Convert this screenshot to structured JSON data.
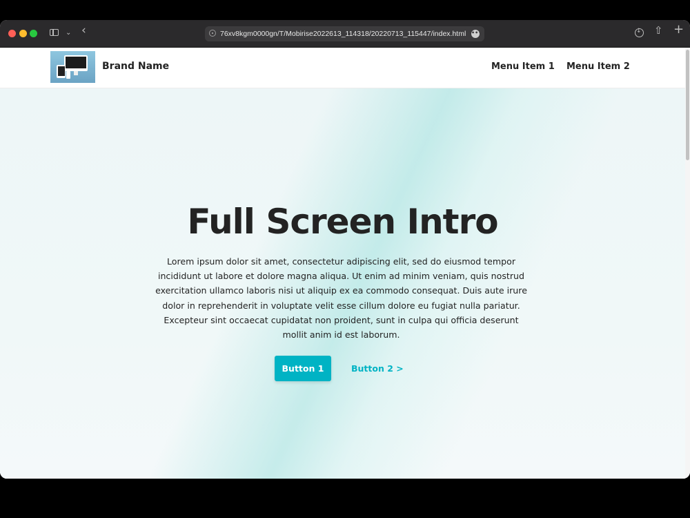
{
  "browser": {
    "url": "76xv8kgm0000gn/T/Mobirise2022613_114318/20220713_115447/index.html",
    "more_glyph": "•••",
    "back_glyph": "‹",
    "chevron_glyph": "⌄",
    "share_glyph": "⇧",
    "plus_glyph": "+"
  },
  "navbar": {
    "brand_name": "Brand Name",
    "menu_items": [
      {
        "label": "Menu Item 1"
      },
      {
        "label": "Menu Item 2"
      }
    ]
  },
  "hero": {
    "title": "Full Screen Intro",
    "text": "Lorem ipsum dolor sit amet, consectetur adipiscing elit, sed do eiusmod tempor incididunt ut labore et dolore magna aliqua. Ut enim ad minim veniam, quis nostrud exercitation ullamco laboris nisi ut aliquip ex ea commodo consequat. Duis aute irure dolor in reprehenderit in voluptate velit esse cillum dolore eu fugiat nulla pariatur. Excepteur sint occaecat cupidatat non proident, sunt in culpa qui officia deserunt mollit anim id est laborum.",
    "button_primary": "Button 1",
    "button_secondary": "Button 2 >"
  },
  "colors": {
    "accent": "#00b3c4",
    "text": "#232323",
    "titlebar": "#2b2a2c"
  }
}
